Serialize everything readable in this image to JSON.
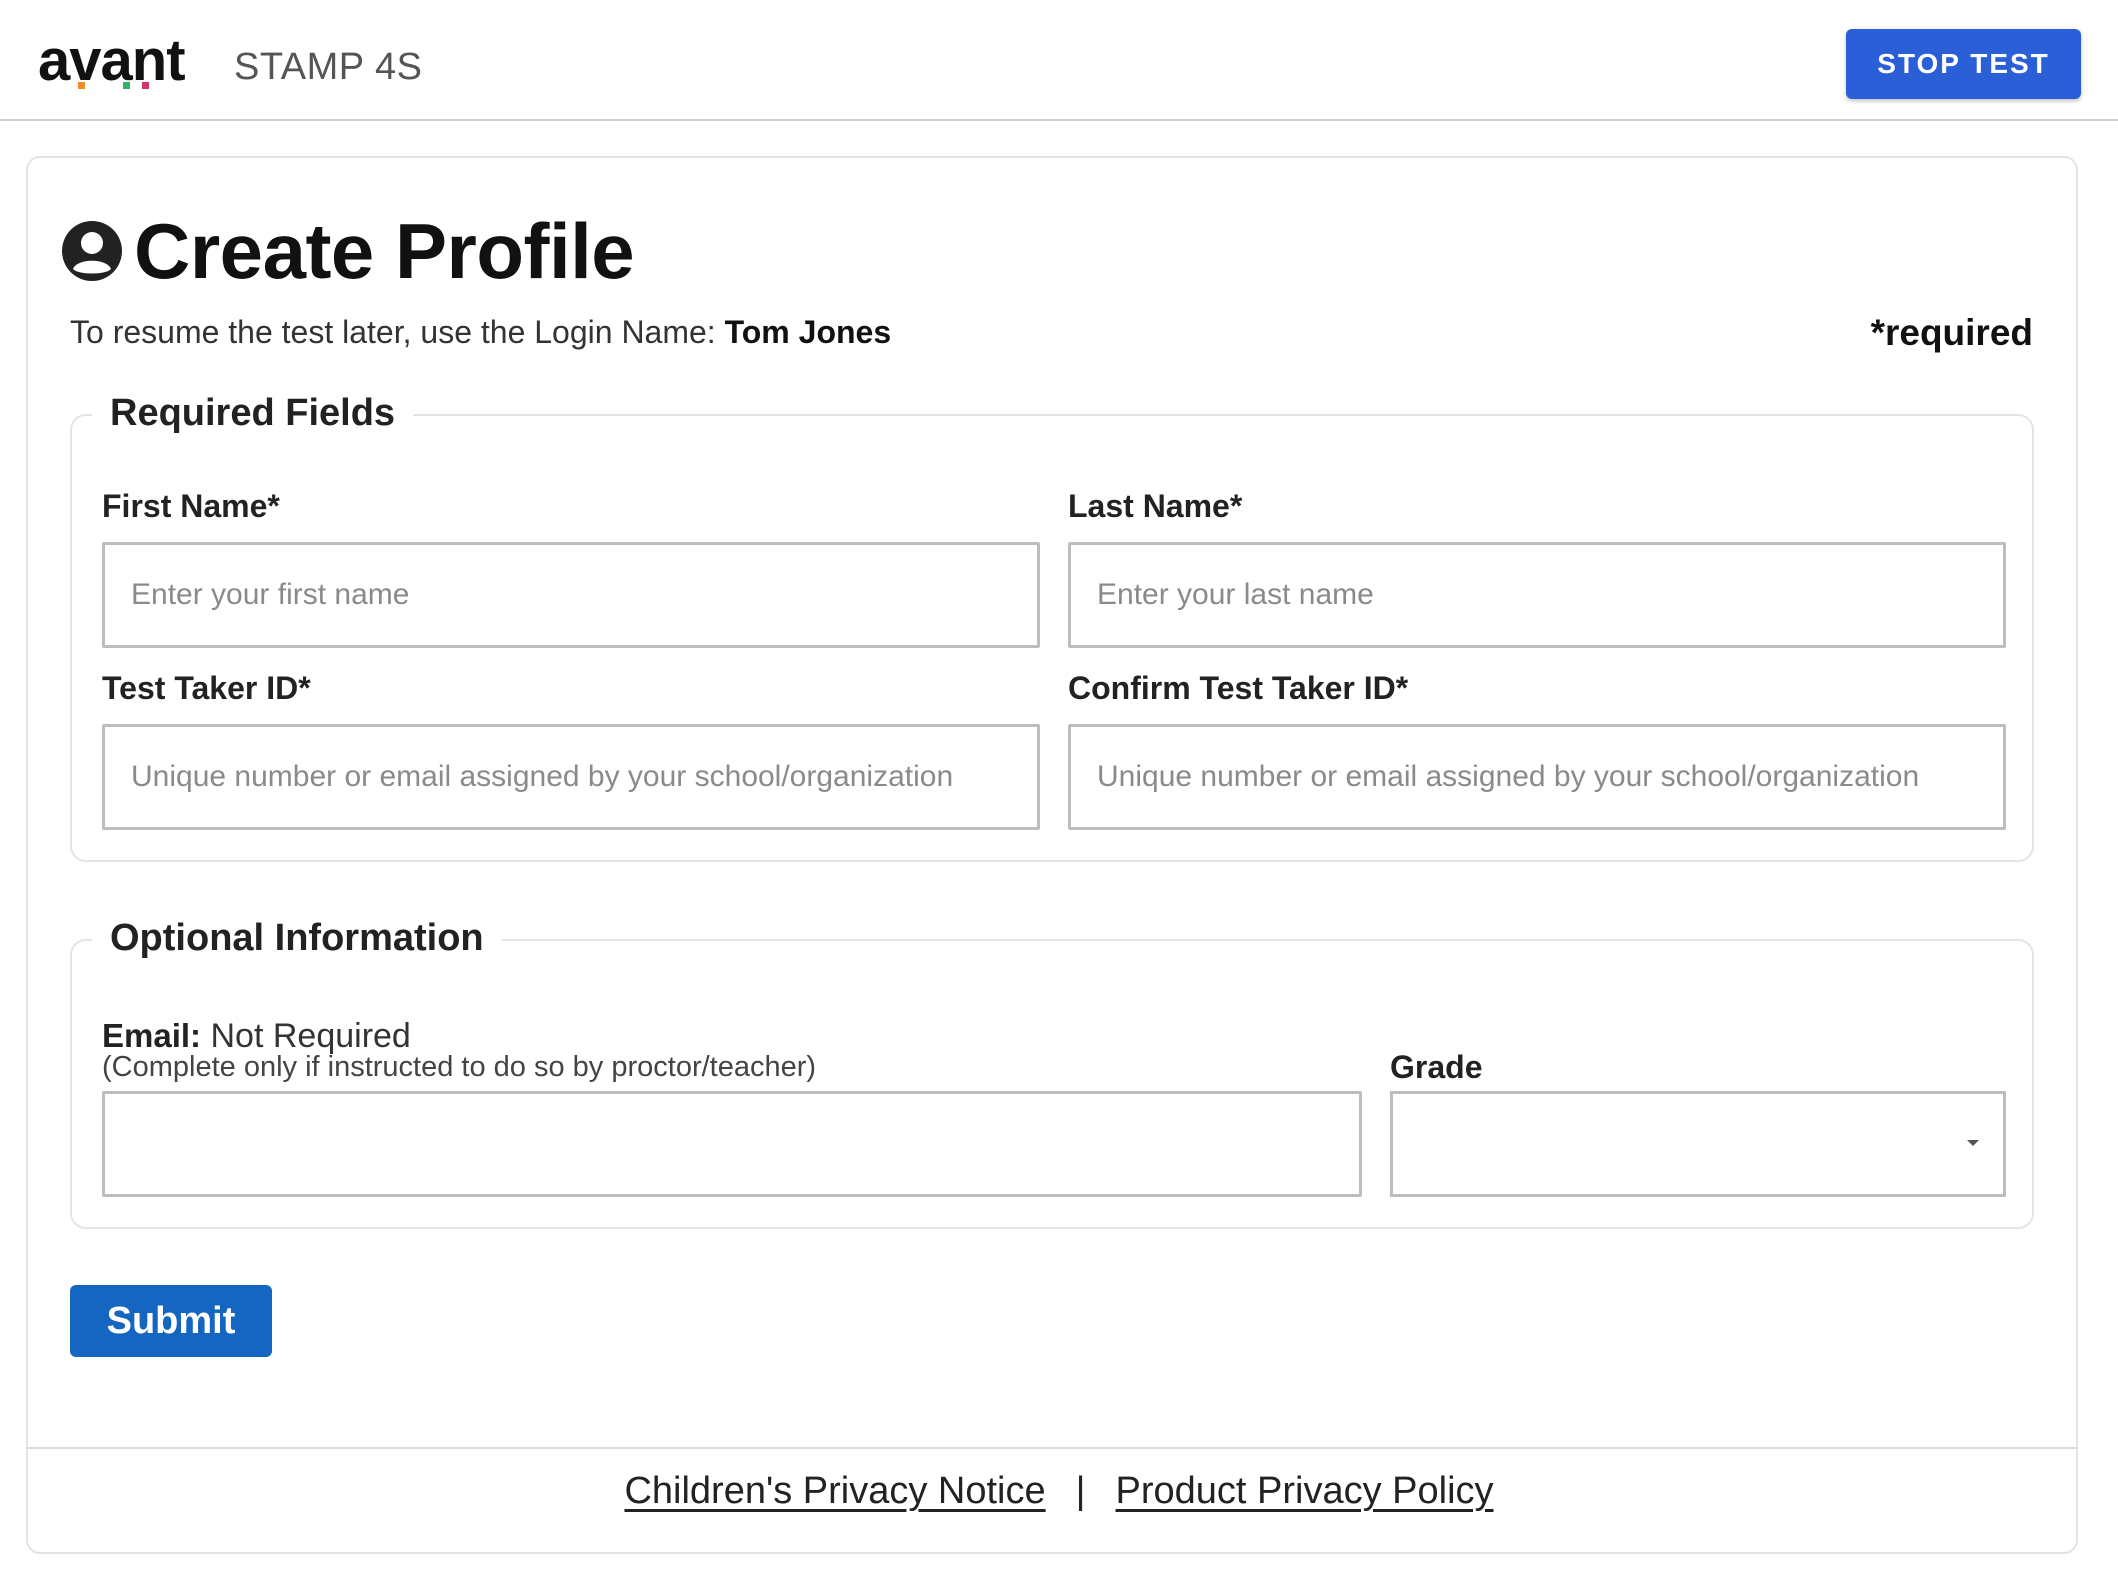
{
  "header": {
    "brand": "avant",
    "product": "STAMP 4S",
    "stop_label": "STOP TEST"
  },
  "page": {
    "title": "Create Profile",
    "resume_prefix": "To resume the test later, use the Login Name: ",
    "login_name": "Tom Jones",
    "required_note": "*required"
  },
  "required_section": {
    "legend": "Required Fields",
    "first_name_label": "First Name*",
    "first_name_placeholder": "Enter your first name",
    "first_name_value": "",
    "last_name_label": "Last Name*",
    "last_name_placeholder": "Enter your last name",
    "last_name_value": "",
    "taker_id_label": "Test Taker ID*",
    "taker_id_placeholder": "Unique number or email assigned by your school/organization",
    "taker_id_value": "",
    "confirm_id_label": "Confirm Test Taker ID*",
    "confirm_id_placeholder": "Unique number or email assigned by your school/organization",
    "confirm_id_value": ""
  },
  "optional_section": {
    "legend": "Optional Information",
    "email_label": "Email:",
    "email_status": "Not Required",
    "email_hint": "(Complete only if instructed to do so by proctor/teacher)",
    "email_value": "",
    "grade_label": "Grade",
    "grade_value": ""
  },
  "actions": {
    "submit_label": "Submit"
  },
  "footer": {
    "childrens_privacy": "Children's Privacy Notice",
    "separator": "|",
    "product_privacy": "Product Privacy Policy"
  },
  "colors": {
    "stop_button": "#2a5fd8",
    "submit_button": "#1566c0",
    "logo_accent_orange": "#f28c28",
    "logo_accent_pink": "#d6336c",
    "logo_accent_green": "#2fb36b"
  },
  "icons": {
    "title_icon": "account-circle-icon",
    "grade_select_icon": "caret-down-icon"
  }
}
